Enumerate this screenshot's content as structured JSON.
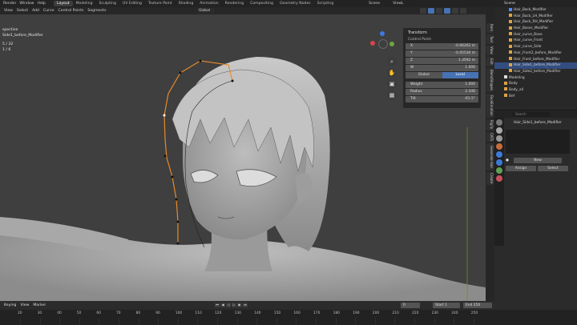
{
  "top_menu": [
    "Render",
    "Window",
    "Help"
  ],
  "workspaces": [
    "Layout",
    "Modeling",
    "Sculpting",
    "UV Editing",
    "Texture Paint",
    "Shading",
    "Animation",
    "Rendering",
    "Compositing",
    "Geometry Nodes",
    "Scripting"
  ],
  "active_workspace": "Layout",
  "scene_label": "Scene",
  "view_layer_label": "ViewL",
  "viewport_header": {
    "items": [
      "View",
      "Select",
      "Add",
      "Curve",
      "Control Points",
      "Segments"
    ],
    "transform_orientation": "Global"
  },
  "overlay": {
    "line1": "spective",
    "line2": "Side1_before_Modifier",
    "line3": "5 / 32",
    "line4": "1 / 6"
  },
  "transform_panel": {
    "title": "Transform",
    "subtitle": "Control Point:",
    "fields": [
      {
        "label": "X",
        "value": "-0.06202 m"
      },
      {
        "label": "Y",
        "value": "-0.05530 m"
      },
      {
        "label": "Z",
        "value": "1.3592 m"
      },
      {
        "label": "W",
        "value": "1.000"
      }
    ],
    "modes": [
      "Global",
      "Local"
    ],
    "active_mode": "Local",
    "props": [
      {
        "label": "Weight",
        "value": "1.000"
      },
      {
        "label": "Radius",
        "value": "2.346"
      },
      {
        "label": "Tilt",
        "value": "-61.5°"
      }
    ]
  },
  "side_tabs": [
    "Item",
    "Tool",
    "View",
    "Edit",
    "BlendShapes",
    "FaceEmotion",
    "Rigify",
    "CATS",
    "Generate Hair",
    "Create"
  ],
  "outliner": {
    "rows": [
      {
        "label": "Hair_Back_Modifier",
        "color": "#4f8cff"
      },
      {
        "label": "Hair_Back_LH_Modifier",
        "color": "#e0a341"
      },
      {
        "label": "Hair_Back_RH_Modifier",
        "color": "#e0a341"
      },
      {
        "label": "Hair_Bases_Modifier",
        "color": "#e0a341"
      },
      {
        "label": "Hair_curve_Base",
        "color": "#e0a341"
      },
      {
        "label": "Hair_curve_Front",
        "color": "#e0a341"
      },
      {
        "label": "Hair_curve_Side",
        "color": "#e0a341"
      },
      {
        "label": "Hair_Front2_before_Modifier",
        "color": "#e0a341"
      },
      {
        "label": "Hair_Front_before_Modifier",
        "color": "#e0a341"
      },
      {
        "label": "Hair_Side1_before_Modifier",
        "color": "#e0a341",
        "selected": true
      },
      {
        "label": "Hair_Side2_before_Modifier",
        "color": "#e0a341"
      },
      {
        "label": "Modeling",
        "color": "#dddddd"
      },
      {
        "label": "Body",
        "color": "#e0a341"
      },
      {
        "label": "Body_all",
        "color": "#e0a341"
      },
      {
        "label": "Bef",
        "color": "#e0a341"
      }
    ]
  },
  "properties": {
    "search_placeholder": "Search",
    "object_name": "Hair_Side1_before_Modifier",
    "new_label": "New",
    "assign_label": "Assign",
    "select_label": "Select"
  },
  "timeline": {
    "items": [
      "Keying",
      "View",
      "Marker"
    ],
    "current_frame": "0",
    "start_label": "Start",
    "start_value": "1",
    "end_label": "End",
    "end_value": "250",
    "ticks": [
      "20",
      "30",
      "40",
      "50",
      "60",
      "70",
      "80",
      "90",
      "100",
      "110",
      "120",
      "130",
      "140",
      "150",
      "160",
      "170",
      "180",
      "190",
      "200",
      "210",
      "220",
      "230",
      "240",
      "250"
    ]
  }
}
